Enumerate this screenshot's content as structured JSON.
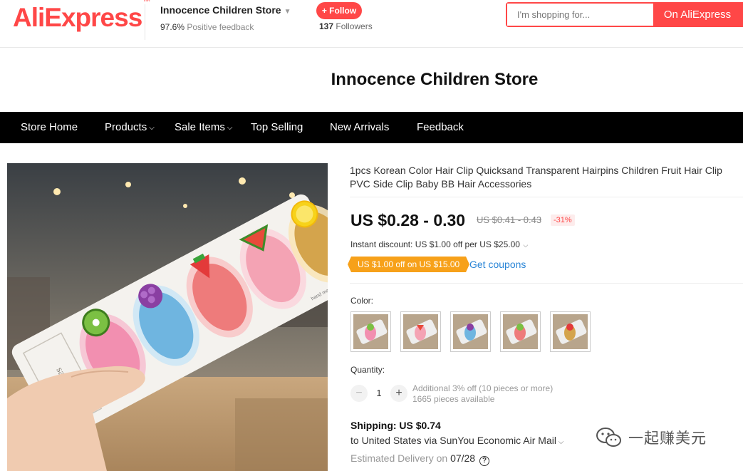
{
  "header": {
    "logo": "AliExpress",
    "logo_tm": "TM",
    "store_name": "Innocence Children Store",
    "feedback_percent": "97.6%",
    "feedback_label": "Positive feedback",
    "follow_label": "+ Follow",
    "followers_count": "137",
    "followers_label": "Followers",
    "search_placeholder": "I'm shopping for...",
    "search_button": "On AliExpress"
  },
  "banner": {
    "title": "Innocence Children Store"
  },
  "nav": {
    "items": [
      "Store Home",
      "Products",
      "Sale Items",
      "Top Selling",
      "New Arrivals",
      "Feedback"
    ]
  },
  "product": {
    "title": "1pcs Korean Color Hair Clip Quicksand Transparent Hairpins Children Fruit Hair Clip PVC Side Clip Baby BB Hair Accessories",
    "price": "US $0.28 - 0.30",
    "old_price": "US $0.41 - 0.43",
    "discount": "-31%",
    "instant_discount": "Instant discount: US $1.00 off per US $25.00",
    "coupon": "US $1.00 off on US $15.00",
    "get_coupons": "Get coupons",
    "color_label": "Color:",
    "quantity_label": "Quantity:",
    "quantity_value": "1",
    "additional_off": "Additional 3% off (10 pieces or more)",
    "pieces_available": "1665 pieces available",
    "shipping": "Shipping: US $0.74",
    "ship_to": "to United States via SunYou Economic Air Mail",
    "delivery_label": "Estimated Delivery on",
    "delivery_date": "07/28",
    "image_brand": "sayoung",
    "image_note": "hand made"
  },
  "watermark": {
    "text": "一起赚美元"
  },
  "colors": {
    "accent": "#ff4747",
    "coupon": "#f7a11a",
    "link": "#2b86d7",
    "nav_bg": "#000000"
  }
}
